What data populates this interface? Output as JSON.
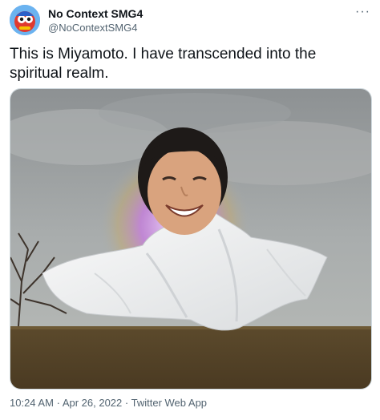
{
  "tweet": {
    "display_name": "No Context SMG4",
    "handle": "@NoContextSMG4",
    "more_icon": "more-horizontal-icon",
    "text": "This is Miyamoto. I have transcended into the spiritual realm.",
    "time": "10:24 AM",
    "date": "Apr 26, 2022",
    "source": "Twitter Web App",
    "separator": "·"
  },
  "colors": {
    "text": "#0f1419",
    "secondary": "#536471",
    "border": "#cfd9de"
  },
  "media": {
    "description_icon": "ghost-photo"
  }
}
